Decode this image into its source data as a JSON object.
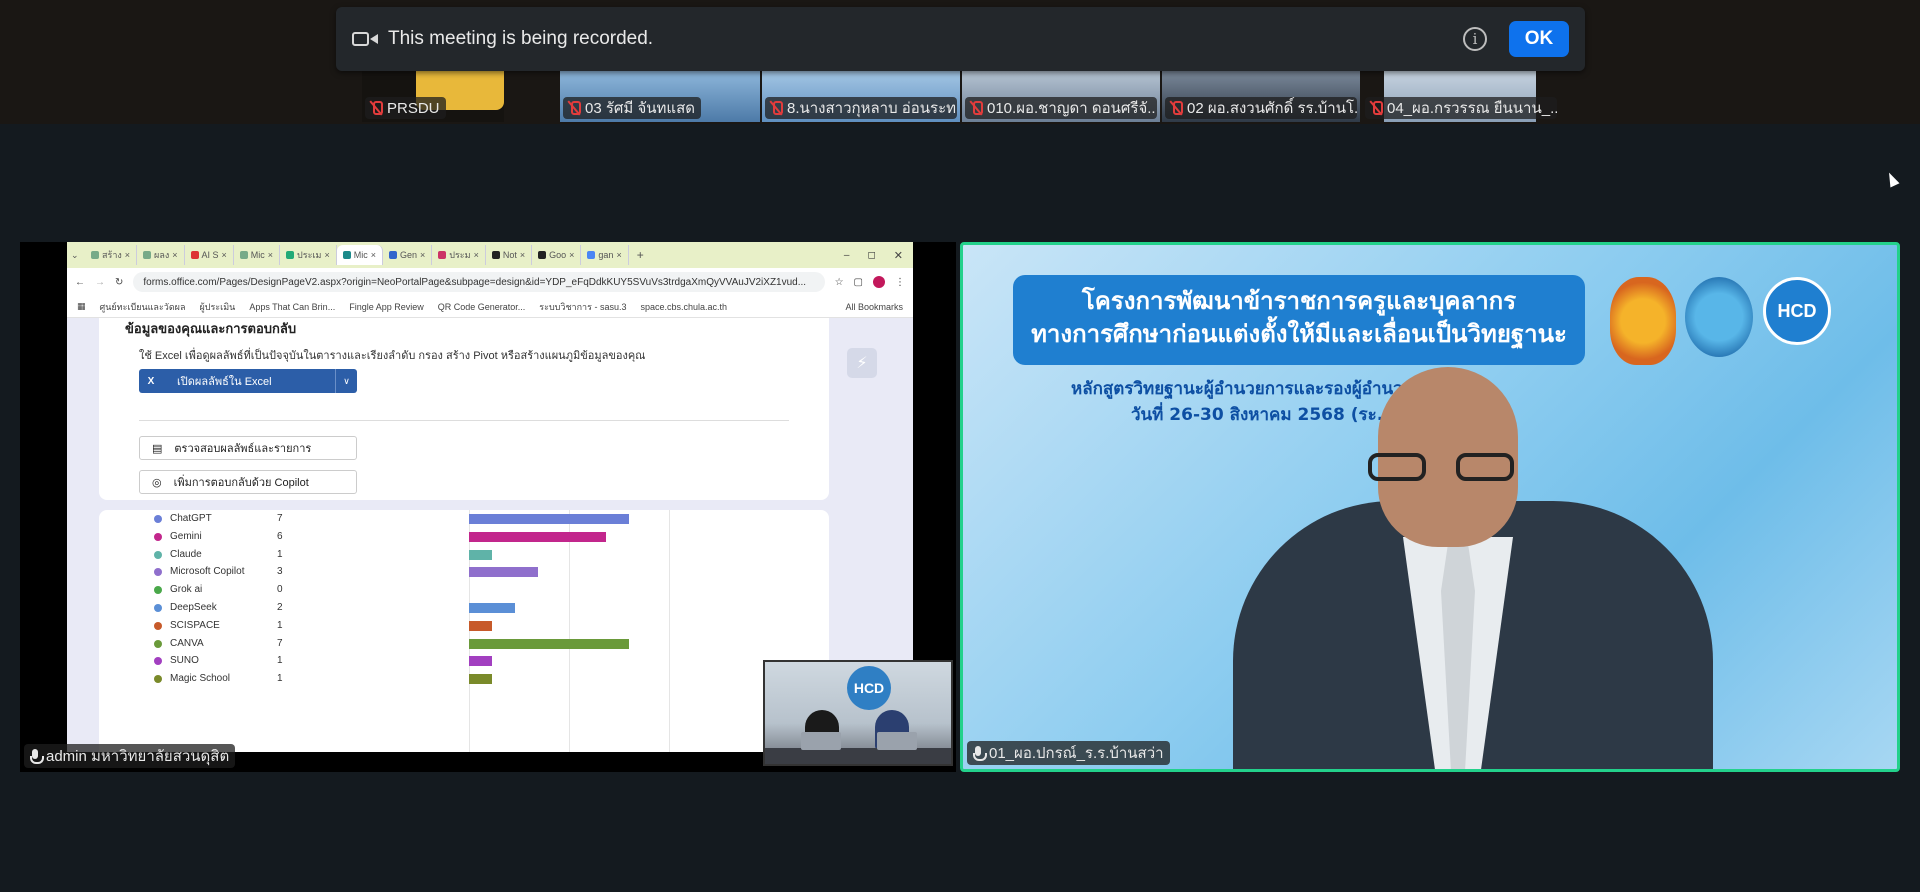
{
  "recording_banner": {
    "text": "This meeting is being recorded.",
    "info": "i",
    "ok_label": "OK"
  },
  "filmstrip": [
    {
      "name": "PRSDU",
      "muted": true,
      "color": "#e8b83a"
    },
    {
      "name": "03 รัศมี จันทแสด",
      "muted": true,
      "color": "#6fa7d8"
    },
    {
      "name": "8.นางสาวกุหลาบ อ่อนระทา...",
      "muted": true,
      "color": "#8ab5de"
    },
    {
      "name": "010.ผอ.ชาญดา ดอนศรีจั...",
      "muted": true,
      "color": "#7e9bbd"
    },
    {
      "name": "02 ผอ.สงวนศักดิ์ รร.บ้านโ...",
      "muted": true,
      "color": "#5b6d82"
    },
    {
      "name": "04_ผอ.กรวรรณ ยืนนาน_...",
      "muted": true,
      "color": "#9fb4c9"
    }
  ],
  "left_panel": {
    "name_tag": "admin มหาวิทยาลัยสวนดุสิต",
    "browser": {
      "tabs": [
        "สร้าง",
        "ผลง",
        "AI S",
        "Mic",
        "ประเม",
        "Mic",
        "Gen",
        "ประม",
        "Not",
        "Goo",
        "gan"
      ],
      "active_tab": 5,
      "url": "forms.office.com/Pages/DesignPageV2.aspx?origin=NeoPortalPage&subpage=design&id=YDP_eFqDdkKUY5SVuVs3trdgaXmQyVVAuJV2iXZ1vud...",
      "bookmarks": [
        "ศูนย์ทะเบียนและวัดผล",
        "ผู้ประเมิน",
        "Apps That Can Brin...",
        "Fingle App Review",
        "QR Code Generator...",
        "ระบบวิชาการ - sasu.3",
        "space.cbs.chula.ac.th",
        "All Bookmarks"
      ]
    },
    "form": {
      "heading": "ข้อมูลของคุณและการตอบกลับ",
      "description": "ใช้ Excel เพื่อดูผลลัพธ์ที่เป็นปัจจุบันในตารางและเรียงลำดับ กรอง สร้าง Pivot หรือสร้างแผนภูมิข้อมูลของคุณ",
      "excel_button": "เปิดผลลัพธ์ใน Excel",
      "review_button": "ตรวจสอบผลลัพธ์และรายการ",
      "copilot_button": "เพิ่มการตอบกลับด้วย Copilot"
    },
    "chart_data": {
      "type": "bar",
      "categories": [
        "ChatGPT",
        "Gemini",
        "Claude",
        "Microsoft Copilot",
        "Grok ai",
        "DeepSeek",
        "SCISPACE",
        "CANVA",
        "SUNO",
        "Magic School"
      ],
      "values": [
        7,
        6,
        1,
        3,
        0,
        2,
        1,
        7,
        1,
        1
      ],
      "colors": [
        "#6b7fd7",
        "#c2268c",
        "#5fb3a8",
        "#8f6fcc",
        "#4aa84a",
        "#5b8fd6",
        "#c75a2a",
        "#6a9a3a",
        "#a23fc0",
        "#7a8a2a"
      ]
    },
    "taskbar_icons": [
      "start-icon",
      "search-icon",
      "copilot-icon",
      "folder-icon",
      "chrome-icon",
      "edge-icon",
      "excel-icon",
      "word-icon",
      "powerpoint-icon",
      "paint-icon",
      "calculator-icon",
      "capcut-icon",
      "outlook-icon",
      "chrome-icon",
      "chrome-icon",
      "media-icon"
    ],
    "pip_logo": "HCD"
  },
  "right_panel": {
    "name_tag": "01_ผอ.ปกรณ์_ร.ร.บ้านสว่า",
    "title_line1": "โครงการพัฒนาข้าราชการครูและบุคลากร",
    "title_line2": "ทางการศึกษาก่อนแต่งตั้งให้มีและเลื่อนเป็นวิทยฐานะ",
    "sub_line1": "หลักสูตรวิทยฐานะผู้อำนวยการและรองผู้อำนวยการ...ญ",
    "sub_line2": "วันที่ 26-30 สิงหาคม 2568 (ระ...",
    "logo_hcd": "HCD"
  }
}
